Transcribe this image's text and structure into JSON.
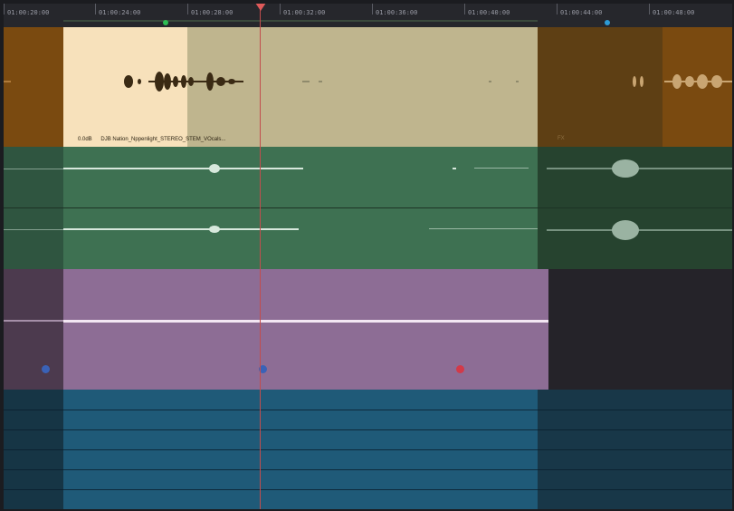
{
  "timeline": {
    "timecodes": [
      "01:00:20:00",
      "01:00:24:00",
      "01:00:28:00",
      "01:00:32:00",
      "01:00:36:00",
      "01:00:40:00",
      "01:00:44:00",
      "01:00:48:00"
    ],
    "playhead_time": "01:00:29:08"
  },
  "tracks": {
    "audio_clip_1": {
      "gain": "0.0dB",
      "name": "DJB Nation_Nppenlight_STEREO_STEM_VOcals...",
      "ghost_label": "FX",
      "colors": {
        "base": "#7a4a10",
        "selected_light": "#f7e1bb",
        "selected_muted": "#bfb58e",
        "muted_region": "#5e3f14"
      }
    },
    "audio_clip_2": {
      "colors": {
        "base": "#2f5540",
        "selected": "#3e7152",
        "dim": "#26432f"
      }
    },
    "video_clip": {
      "colors": {
        "base": "#4c3a4e",
        "selected": "#8d6d95",
        "empty": "#252329"
      },
      "keyframes": [
        {
          "color": "#3a62b7"
        },
        {
          "color": "#3a62b7"
        },
        {
          "color": "#d23a49"
        }
      ]
    },
    "bottom_lanes": {
      "colors": {
        "base": "#163545",
        "selected": "#1f5a78",
        "dim": "#183748"
      },
      "lane_count": 6
    }
  },
  "markers": {
    "in_marker_color": "#2ebd52",
    "out_marker_color": "#2d9bd6",
    "playhead_color": "#e05a5a"
  }
}
